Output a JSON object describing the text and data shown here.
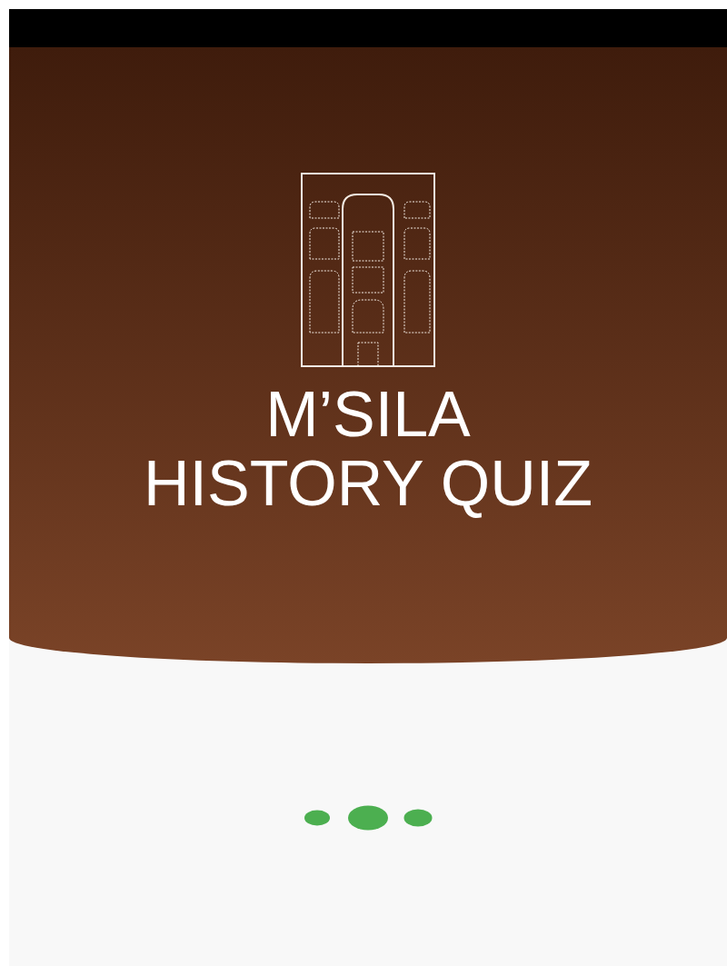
{
  "title_lines": [
    "M’SILA",
    "HISTORY QUIZ"
  ]
}
